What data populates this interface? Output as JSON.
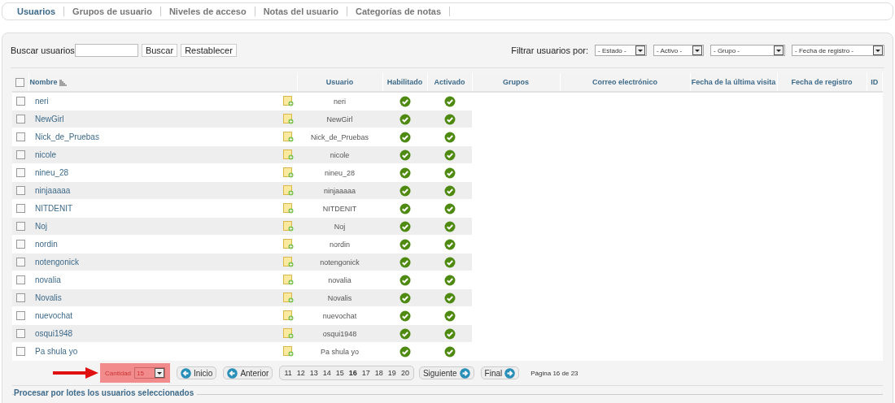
{
  "tabs": [
    {
      "label": "Usuarios",
      "selected": true
    },
    {
      "label": "Grupos de usuario",
      "selected": false
    },
    {
      "label": "Niveles de acceso",
      "selected": false
    },
    {
      "label": "Notas del usuario",
      "selected": false
    },
    {
      "label": "Categorías de notas",
      "selected": false
    }
  ],
  "search": {
    "label": "Buscar usuarios",
    "buttons": [
      "Buscar",
      "Restablecer"
    ]
  },
  "filters": {
    "label": "Filtrar usuarios por:",
    "selects": [
      "- Estado -",
      "- Activo -",
      "- Grupo -",
      "- Fecha de registro -"
    ]
  },
  "table": {
    "select_all_checked": false,
    "columns": [
      "Nombre",
      "Usuario",
      "Habilitado",
      "Activado",
      "Grupos",
      "Correo electrónico",
      "Fecha de la última visita",
      "Fecha de registro",
      "ID"
    ],
    "rows": [
      {
        "name": "neri",
        "username": "neri",
        "checked": false,
        "enabled": true,
        "activated": true
      },
      {
        "name": "NewGirl",
        "username": "NewGirl",
        "checked": false,
        "enabled": true,
        "activated": true
      },
      {
        "name": "Nick_de_Pruebas",
        "username": "Nick_de_Pruebas",
        "checked": false,
        "enabled": true,
        "activated": true
      },
      {
        "name": "nicole",
        "username": "nicole",
        "checked": false,
        "enabled": true,
        "activated": true
      },
      {
        "name": "nineu_28",
        "username": "nineu_28",
        "checked": false,
        "enabled": true,
        "activated": true
      },
      {
        "name": "ninjaaaaa",
        "username": "ninjaaaaa",
        "checked": false,
        "enabled": true,
        "activated": true
      },
      {
        "name": "NITDENIT",
        "username": "NITDENIT",
        "checked": false,
        "enabled": true,
        "activated": true
      },
      {
        "name": "Noj",
        "username": "Noj",
        "checked": false,
        "enabled": true,
        "activated": true
      },
      {
        "name": "nordin",
        "username": "nordin",
        "checked": false,
        "enabled": true,
        "activated": true
      },
      {
        "name": "notengonick",
        "username": "notengonick",
        "checked": false,
        "enabled": true,
        "activated": true
      },
      {
        "name": "novalia",
        "username": "novalia",
        "checked": false,
        "enabled": true,
        "activated": true
      },
      {
        "name": "Novalis",
        "username": "Novalis",
        "checked": false,
        "enabled": true,
        "activated": true
      },
      {
        "name": "nuevochat",
        "username": "nuevochat",
        "checked": false,
        "enabled": true,
        "activated": true
      },
      {
        "name": "osqui1948",
        "username": "osqui1948",
        "checked": false,
        "enabled": true,
        "activated": true
      },
      {
        "name": "Pa shula yo",
        "username": "Pa shula yo",
        "checked": false,
        "enabled": true,
        "activated": true
      }
    ]
  },
  "pagination": {
    "limit_label": "Cantidad",
    "limit_value": "15",
    "start": "Inicio",
    "prev": "Anterior",
    "pages": [
      {
        "label": "11",
        "selected": false
      },
      {
        "label": "12",
        "selected": false
      },
      {
        "label": "13",
        "selected": false
      },
      {
        "label": "14",
        "selected": false
      },
      {
        "label": "15",
        "selected": false
      },
      {
        "label": "16",
        "selected": true
      },
      {
        "label": "17",
        "selected": false
      },
      {
        "label": "18",
        "selected": false
      },
      {
        "label": "19",
        "selected": false
      },
      {
        "label": "20",
        "selected": false
      }
    ],
    "next": "Siguiente",
    "end": "Final",
    "info": "Página 16 de 23"
  },
  "batch": {
    "title": "Procesar por lotes los usuarios seleccionados"
  }
}
